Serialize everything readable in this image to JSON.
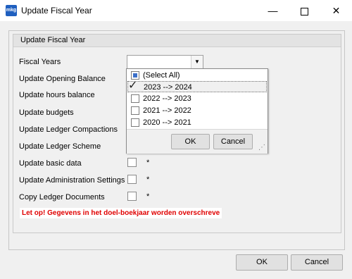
{
  "window": {
    "title": "Update Fiscal Year",
    "icon_text": "mkg",
    "min_glyph": "—",
    "close_glyph": "✕"
  },
  "group": {
    "title": "Update Fiscal Year"
  },
  "fiscal_years": {
    "label": "Fiscal Years",
    "value": "",
    "dropdown_arrow": "▼",
    "options": [
      {
        "label": "(Select All)",
        "state": "partial"
      },
      {
        "label": "2023 --> 2024",
        "state": "checked"
      },
      {
        "label": "2022 --> 2023",
        "state": "unchecked"
      },
      {
        "label": "2021 --> 2022",
        "state": "unchecked"
      },
      {
        "label": "2020 --> 2021",
        "state": "unchecked"
      }
    ],
    "ok_label": "OK",
    "cancel_label": "Cancel"
  },
  "rows": [
    {
      "label": "Update Opening Balance"
    },
    {
      "label": "Update hours balance"
    },
    {
      "label": "Update budgets"
    },
    {
      "label": "Update Ledger Compactions"
    },
    {
      "label": "Update Ledger Scheme"
    },
    {
      "label": "Update basic data",
      "star": "*"
    },
    {
      "label": "Update Administration Settings",
      "star": "*"
    },
    {
      "label": "Copy Ledger Documents",
      "star": "*"
    }
  ],
  "warning": "Let op! Gegevens in het doel-boekjaar worden overschreve",
  "footer": {
    "ok_label": "OK",
    "cancel_label": "Cancel"
  },
  "colors": {
    "warning": "#e00000",
    "accent": "#3b6fc9"
  }
}
